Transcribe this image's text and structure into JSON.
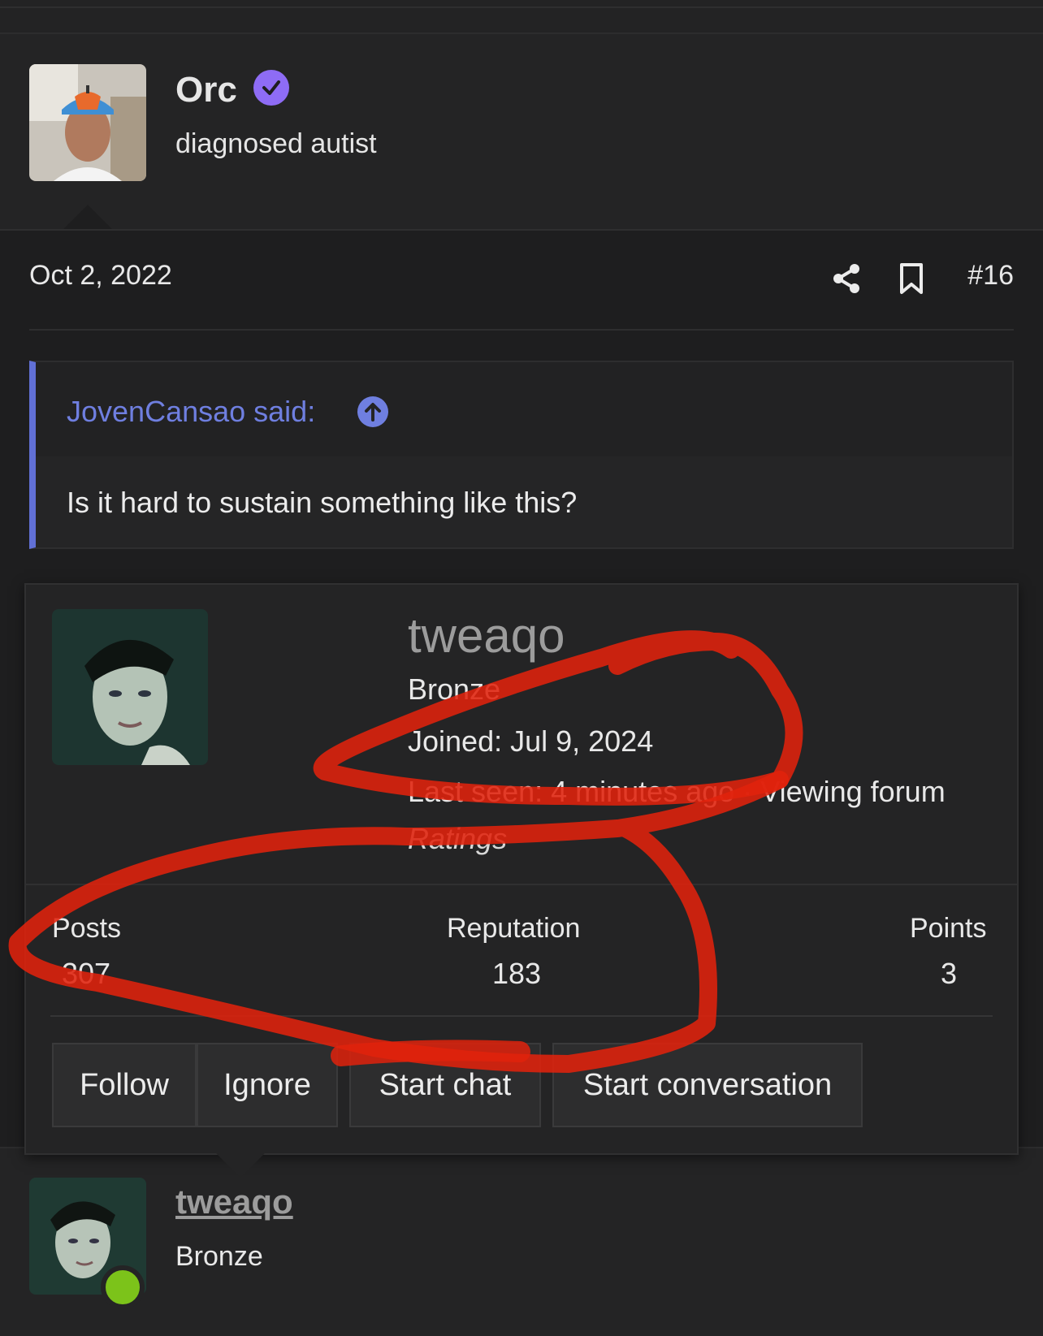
{
  "post": {
    "author": "Orc",
    "author_title": "diagnosed autist",
    "date": "Oct 2, 2022",
    "number": "#16",
    "quote": {
      "author_line": "JovenCansao said:",
      "text": "Is it hard to sustain something like this?"
    }
  },
  "member_tooltip": {
    "username": "tweaqo",
    "rank": "Bronze",
    "joined": "Joined: Jul 9, 2024",
    "last_seen": "Last seen: 4 minutes ago · Viewing forum",
    "ratings_label": "Ratings",
    "stats": [
      {
        "label": "Posts",
        "value": "307"
      },
      {
        "label": "Reputation",
        "value": "183"
      },
      {
        "label": "Points",
        "value": "3"
      }
    ],
    "buttons": {
      "follow": "Follow",
      "ignore": "Ignore",
      "start_chat": "Start chat",
      "start_conversation": "Start conversation"
    }
  },
  "next_post": {
    "author": "tweaqo",
    "author_title": "Bronze",
    "online": true
  },
  "colors": {
    "background": "#1e1e1f",
    "panel": "#242425",
    "accent": "#6f7fe0",
    "verified_badge": "#8e6cf5",
    "online_indicator": "#7cc31a",
    "annotation_scribble": "#e0220c"
  },
  "icons": [
    "verified-check-icon",
    "share-icon",
    "bookmark-icon",
    "jump-up-arrow-icon"
  ]
}
